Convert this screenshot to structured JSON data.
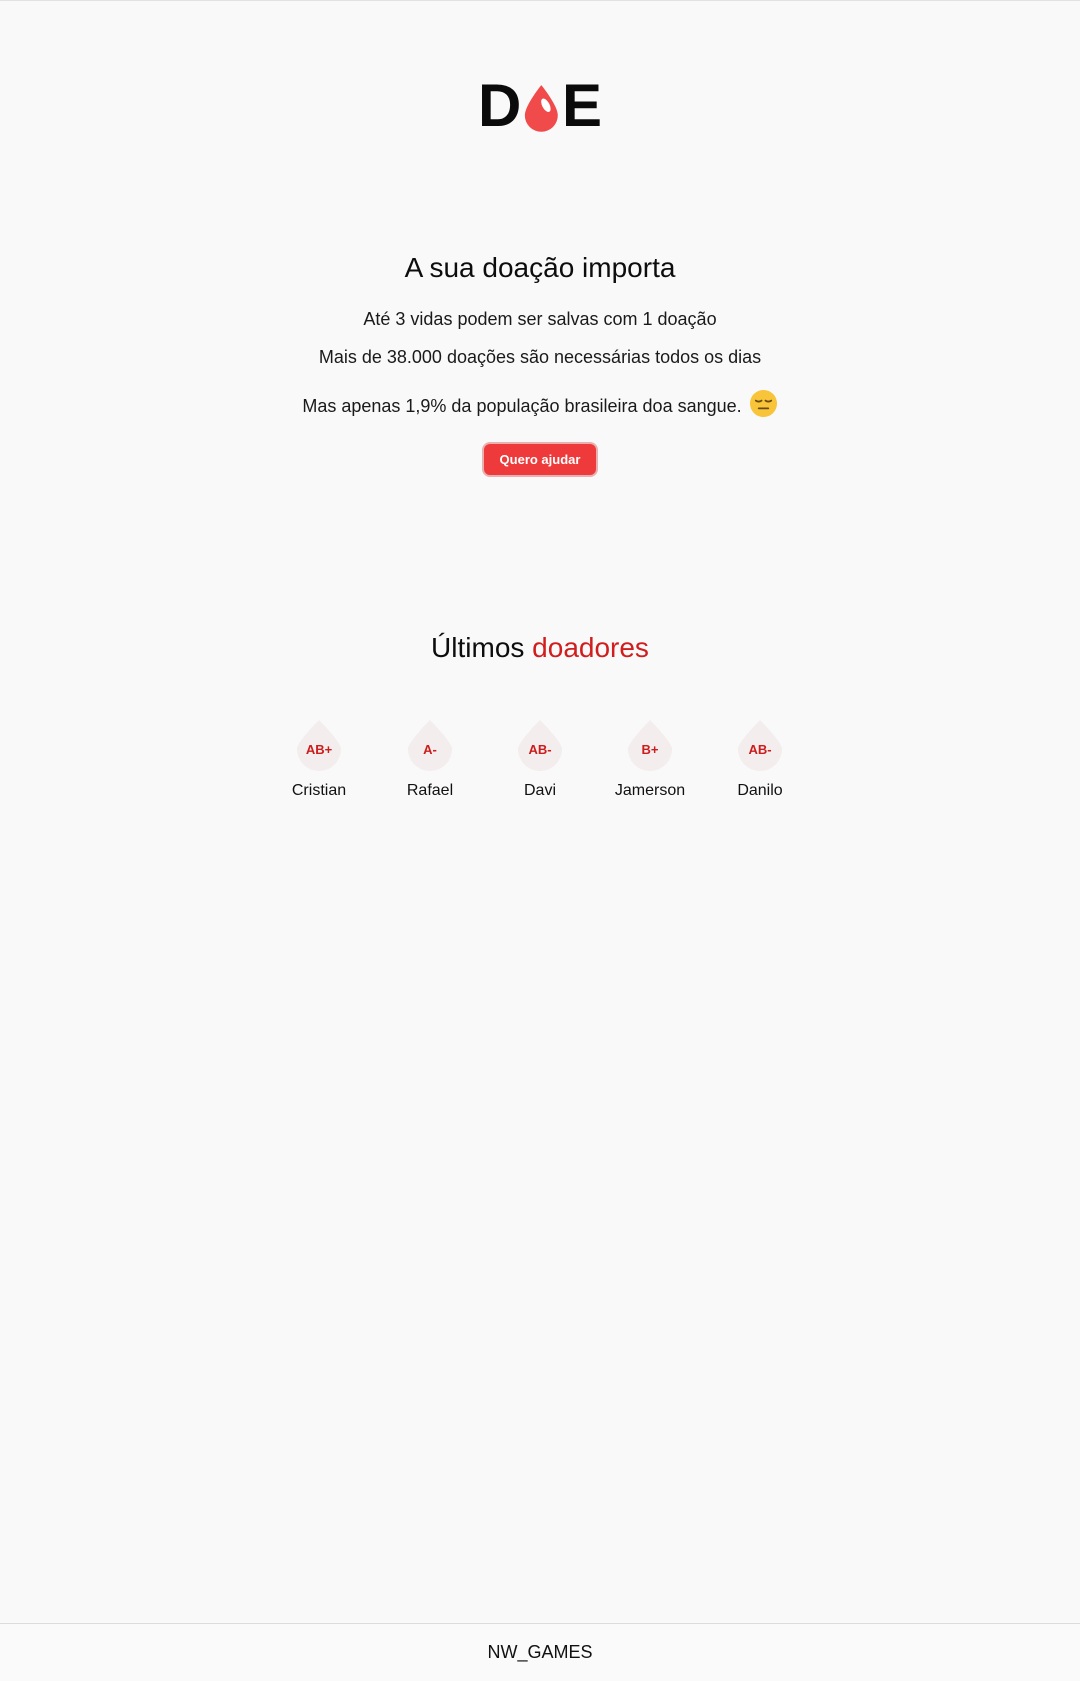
{
  "header": {
    "logo_left": "D",
    "logo_right": "E",
    "logo_drop_color": "#f04a4a"
  },
  "hero": {
    "title": "A sua doação importa",
    "line1": "Até 3 vidas podem ser salvas com 1 doação",
    "line2": "Mais de 38.000 doações são necessárias todos os dias",
    "line3": "Mas apenas 1,9% da população brasileira doa sangue.",
    "emoji_icon": "expressionless-face-icon",
    "cta_label": "Quero ajudar"
  },
  "donors": {
    "title_prefix": "Últimos",
    "title_accent": "doadores",
    "accent_color": "#d11d1d",
    "items": [
      {
        "type": "AB+",
        "name": "Cristian"
      },
      {
        "type": "A-",
        "name": "Rafael"
      },
      {
        "type": "AB-",
        "name": "Davi"
      },
      {
        "type": "B+",
        "name": "Jamerson"
      },
      {
        "type": "AB-",
        "name": "Danilo"
      }
    ]
  },
  "footer": {
    "text": "NW_GAMES"
  }
}
